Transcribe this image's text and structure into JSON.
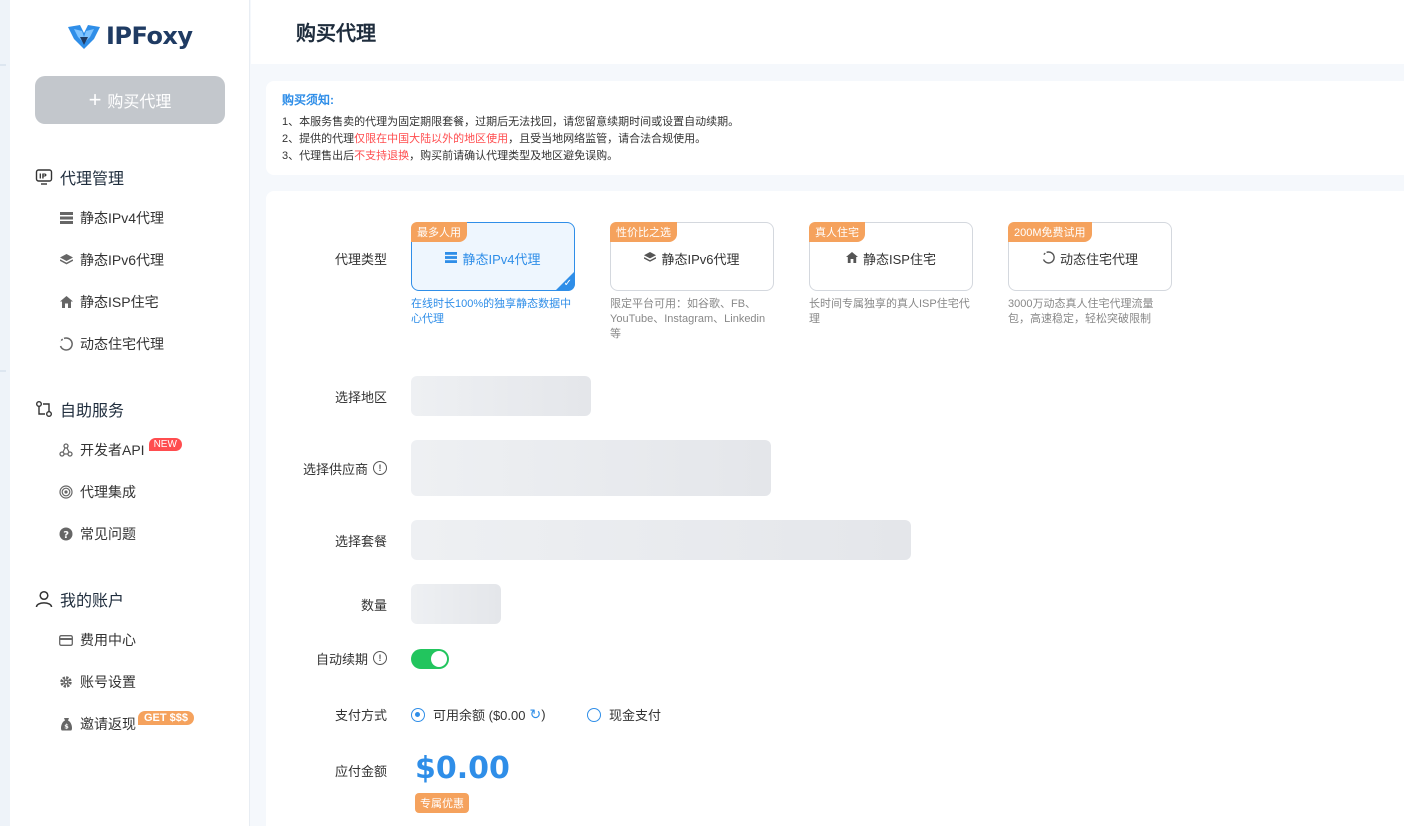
{
  "brand": {
    "name": "IPFoxy"
  },
  "sidebar": {
    "buy_button": "购买代理",
    "groups": [
      {
        "title": "代理管理",
        "icon": "ip-icon",
        "items": [
          {
            "label": "静态IPv4代理",
            "icon": "server-icon"
          },
          {
            "label": "静态IPv6代理",
            "icon": "layers-icon"
          },
          {
            "label": "静态ISP住宅",
            "icon": "home-icon"
          },
          {
            "label": "动态住宅代理",
            "icon": "refresh-icon"
          }
        ]
      },
      {
        "title": "自助服务",
        "icon": "swap-icon",
        "items": [
          {
            "label": "开发者API",
            "icon": "api-icon",
            "badge": "NEW"
          },
          {
            "label": "代理集成",
            "icon": "fingerprint-icon"
          },
          {
            "label": "常见问题",
            "icon": "question-icon"
          }
        ]
      },
      {
        "title": "我的账户",
        "icon": "user-icon",
        "items": [
          {
            "label": "费用中心",
            "icon": "card-icon"
          },
          {
            "label": "账号设置",
            "icon": "gear-icon"
          },
          {
            "label": "邀请返现",
            "icon": "money-bag-icon",
            "badge": "GET $$$"
          }
        ]
      }
    ]
  },
  "header": {
    "title": "购买代理"
  },
  "notice": {
    "title": "购买须知:",
    "line1": "1、本服务售卖的代理为固定期限套餐，过期后无法找回，请您留意续期时间或设置自动续期。",
    "line2_a": "2、提供的代理",
    "line2_red": "仅限在中国大陆以外的地区使用",
    "line2_b": "，且受当地网络监管，请合法合规使用。",
    "line3_a": "3、代理售出后",
    "line3_red": "不支持退换",
    "line3_b": "，购买前请确认代理类型及地区避免误购。"
  },
  "form": {
    "proxy_type_label": "代理类型",
    "region_label": "选择地区",
    "provider_label": "选择供应商",
    "package_label": "选择套餐",
    "quantity_label": "数量",
    "auto_renew_label": "自动续期",
    "auto_renew_on": true,
    "payment_label": "支付方式",
    "amount_label": "应付金额",
    "payment_options": [
      {
        "label": "可用余额 ($0.00",
        "suffix": ")",
        "checked": true
      },
      {
        "label": "现金支付",
        "checked": false
      }
    ],
    "amount": "$0.00",
    "promo": "专属优惠"
  },
  "proxy_types": [
    {
      "tag": "最多人用",
      "name": "静态IPv4代理",
      "icon": "server-icon",
      "desc": "在线时长100%的独享静态数据中心代理",
      "selected": true
    },
    {
      "tag": "性价比之选",
      "name": "静态IPv6代理",
      "icon": "layers-icon",
      "desc": "限定平台可用：如谷歌、FB、YouTube、Instagram、Linkedin等",
      "selected": false
    },
    {
      "tag": "真人住宅",
      "name": "静态ISP住宅",
      "icon": "home-icon",
      "desc": "长时间专属独享的真人ISP住宅代理",
      "selected": false
    },
    {
      "tag": "200M免费试用",
      "name": "动态住宅代理",
      "icon": "refresh-icon",
      "desc": "3000万动态真人住宅代理流量包，高速稳定，轻松突破限制",
      "selected": false
    }
  ],
  "colors": {
    "accent": "#2f8ee8",
    "orange": "#f5a25d",
    "green": "#22c55e",
    "red": "#ff4d4f"
  }
}
